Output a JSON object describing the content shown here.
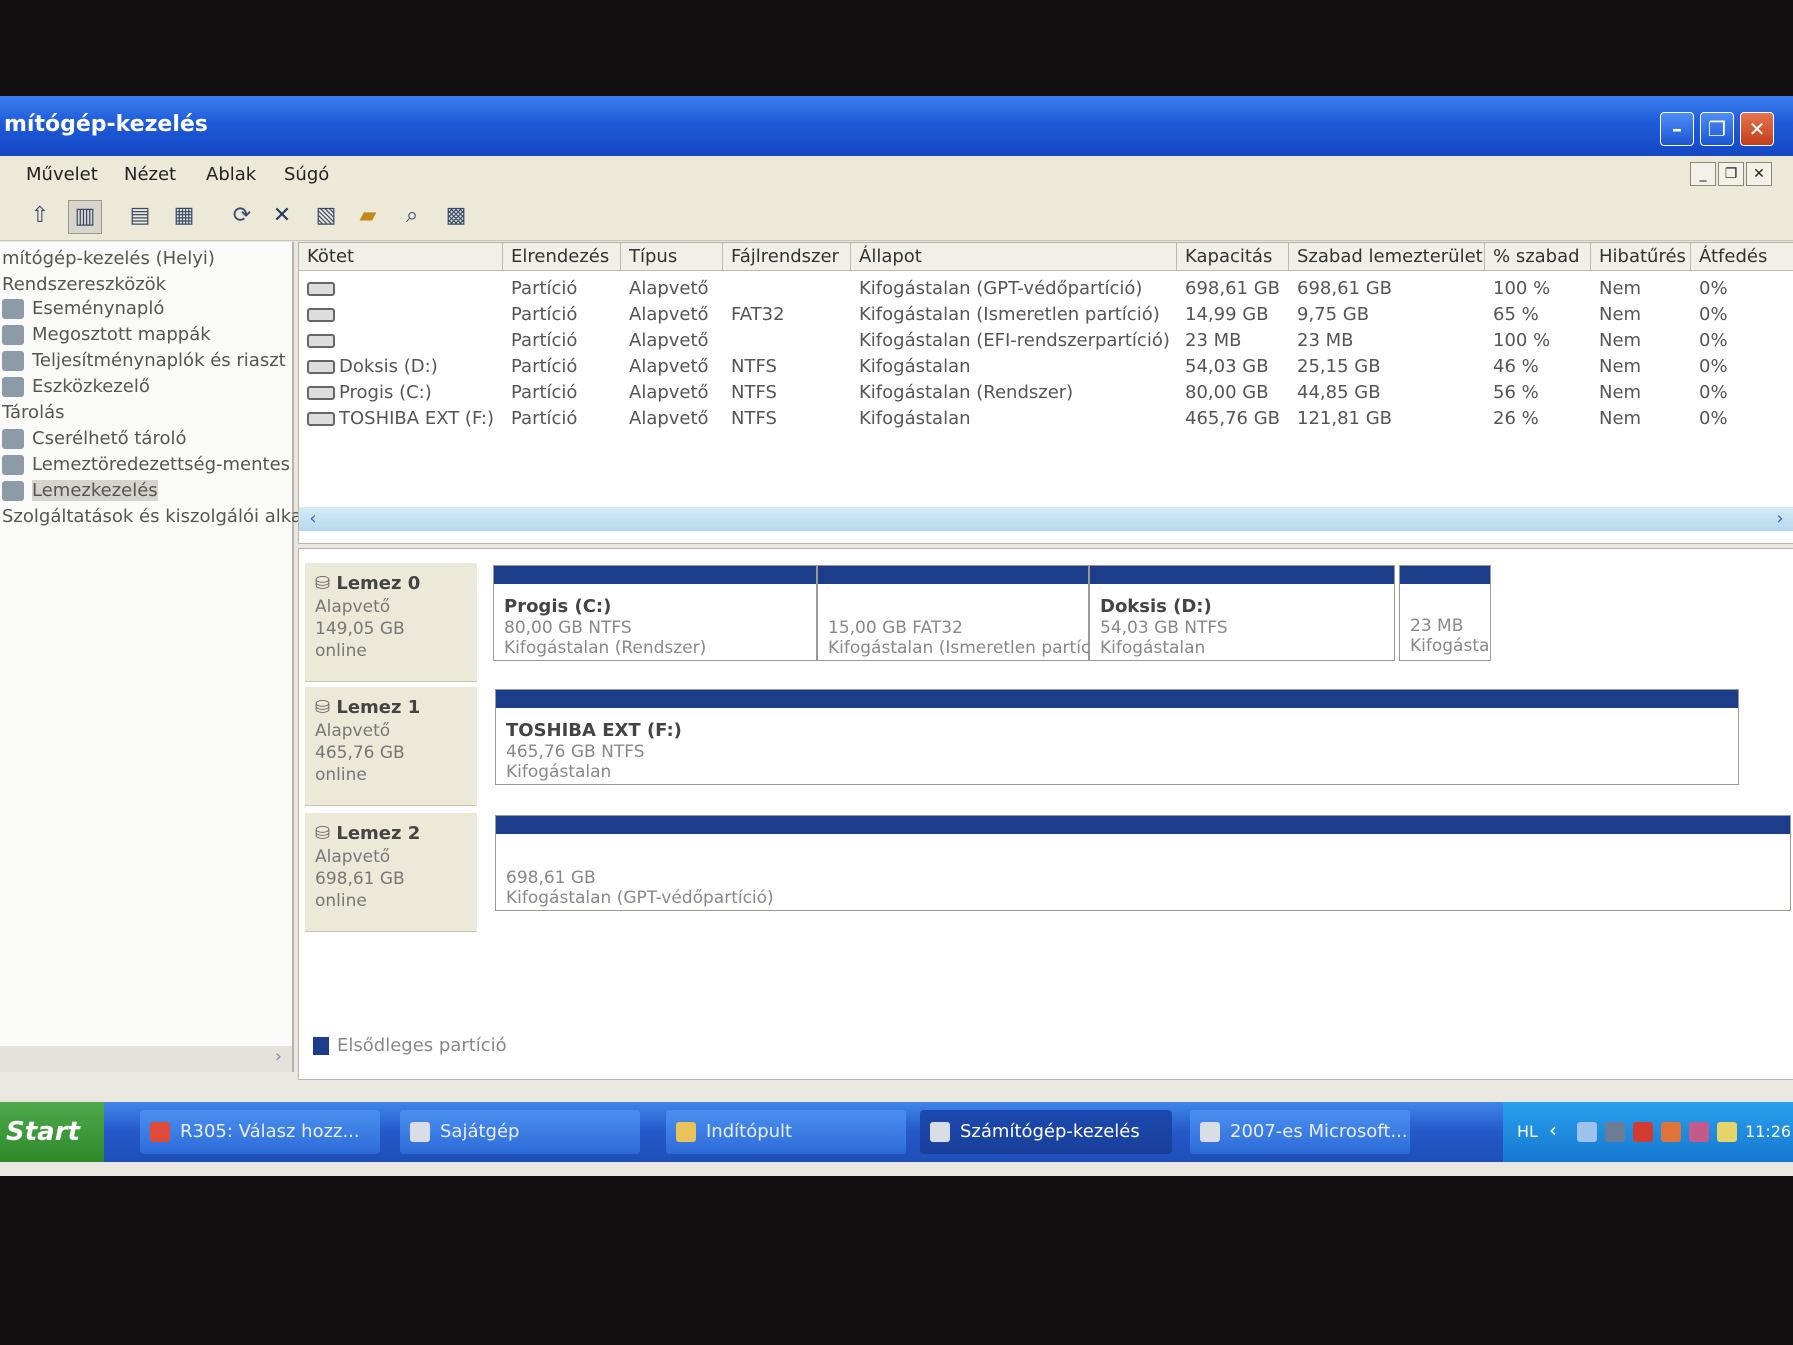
{
  "window": {
    "title": "mítógép-kezelés"
  },
  "menu": [
    "Művelet",
    "Nézet",
    "Ablak",
    "Súgó"
  ],
  "tree": [
    {
      "label": "mítógép-kezelés (Helyi)",
      "indent": 0,
      "icon": ""
    },
    {
      "label": "Rendszereszközök",
      "indent": 0,
      "icon": ""
    },
    {
      "label": "Eseménynapló",
      "indent": 1,
      "icon": "event-log-icon"
    },
    {
      "label": "Megosztott mappák",
      "indent": 1,
      "icon": "shared-folders-icon"
    },
    {
      "label": "Teljesítménynaplók és riaszt",
      "indent": 1,
      "icon": "performance-logs-icon"
    },
    {
      "label": "Eszközkezelő",
      "indent": 1,
      "icon": "device-manager-icon"
    },
    {
      "label": "Tárolás",
      "indent": 0,
      "icon": ""
    },
    {
      "label": "Cserélhető tároló",
      "indent": 1,
      "icon": "removable-storage-icon"
    },
    {
      "label": "Lemeztöredezettség-mentes",
      "indent": 1,
      "icon": "defragmenter-icon"
    },
    {
      "label": "Lemezkezelés",
      "indent": 1,
      "icon": "disk-management-icon",
      "selected": true
    },
    {
      "label": "Szolgáltatások és kiszolgálói alka",
      "indent": 0,
      "icon": ""
    }
  ],
  "table": {
    "headers": [
      "Kötet",
      "Elrendezés",
      "Típus",
      "Fájlrendszer",
      "Állapot",
      "Kapacitás",
      "Szabad lemezterület",
      "% szabad",
      "Hibatűrés",
      "Átfedés"
    ],
    "rows": [
      [
        "",
        "Partíció",
        "Alapvető",
        "",
        "Kifogástalan (GPT-védőpartíció)",
        "698,61 GB",
        "698,61 GB",
        "100 %",
        "Nem",
        "0%"
      ],
      [
        "",
        "Partíció",
        "Alapvető",
        "FAT32",
        "Kifogástalan (Ismeretlen partíció)",
        "14,99 GB",
        "9,75 GB",
        "65 %",
        "Nem",
        "0%"
      ],
      [
        "",
        "Partíció",
        "Alapvető",
        "",
        "Kifogástalan (EFI-rendszerpartíció)",
        "23 MB",
        "23 MB",
        "100 %",
        "Nem",
        "0%"
      ],
      [
        "Doksis (D:)",
        "Partíció",
        "Alapvető",
        "NTFS",
        "Kifogástalan",
        "54,03 GB",
        "25,15 GB",
        "46 %",
        "Nem",
        "0%"
      ],
      [
        "Progis (C:)",
        "Partíció",
        "Alapvető",
        "NTFS",
        "Kifogástalan (Rendszer)",
        "80,00 GB",
        "44,85 GB",
        "56 %",
        "Nem",
        "0%"
      ],
      [
        "TOSHIBA EXT (F:)",
        "Partíció",
        "Alapvető",
        "NTFS",
        "Kifogástalan",
        "465,76 GB",
        "121,81 GB",
        "26 %",
        "Nem",
        "0%"
      ]
    ]
  },
  "disks": [
    {
      "name": "Lemez 0",
      "type": "Alapvető",
      "size": "149,05 GB",
      "status": "online",
      "partitions": [
        {
          "name": "Progis  (C:)",
          "detail": "80,00 GB NTFS",
          "status": "Kifogástalan (Rendszer)"
        },
        {
          "name": "",
          "detail": "15,00 GB FAT32",
          "status": "Kifogástalan (Ismeretlen partíció)"
        },
        {
          "name": "Doksis  (D:)",
          "detail": "54,03 GB NTFS",
          "status": "Kifogástalan"
        },
        {
          "name": "",
          "detail": "23 MB",
          "status": "Kifogásta"
        }
      ]
    },
    {
      "name": "Lemez 1",
      "type": "Alapvető",
      "size": "465,76 GB",
      "status": "online",
      "partitions": [
        {
          "name": "TOSHIBA EXT  (F:)",
          "detail": "465,76 GB NTFS",
          "status": "Kifogástalan"
        }
      ]
    },
    {
      "name": "Lemez 2",
      "type": "Alapvető",
      "size": "698,61 GB",
      "status": "online",
      "partitions": [
        {
          "name": "",
          "detail": "698,61 GB",
          "status": "Kifogástalan (GPT-védőpartíció)"
        }
      ]
    }
  ],
  "legend": {
    "primary_partition": "Elsődleges partíció",
    "color": "#1c3d8a"
  },
  "taskbar": {
    "start": "Start",
    "tasks": [
      {
        "label": "R305: Válasz hozz...",
        "active": false
      },
      {
        "label": "Sajátgép",
        "active": false
      },
      {
        "label": "Indítópult",
        "active": false
      },
      {
        "label": "Számítógép-kezelés",
        "active": true
      },
      {
        "label": "2007-es Microsoft...",
        "active": false
      }
    ],
    "tray": {
      "lang": "HL",
      "clock": "11:26"
    }
  }
}
